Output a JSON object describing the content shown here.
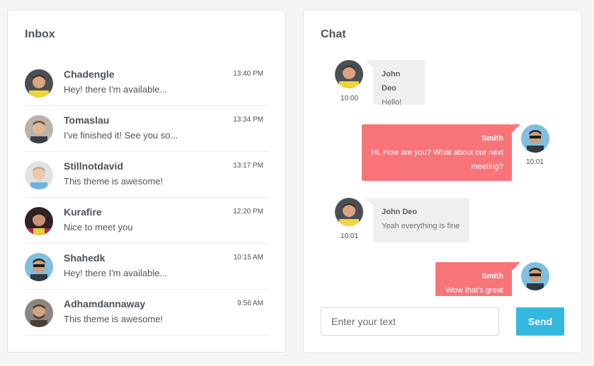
{
  "colors": {
    "page_bg": "#f5f5f5",
    "accent": "#35b8e0",
    "outgoing_bubble": "#f87479",
    "incoming_bubble": "#eeeff0"
  },
  "inbox": {
    "title": "Inbox",
    "items": [
      {
        "name": "Chadengle",
        "message": "Hey! there I'm available...",
        "time": "13:40 PM",
        "avatar": "avatar-icon"
      },
      {
        "name": "Tomaslau",
        "message": "I've finished it! See you so...",
        "time": "13:34 PM",
        "avatar": "avatar-icon"
      },
      {
        "name": "Stillnotdavid",
        "message": "This theme is awesome!",
        "time": "13:17 PM",
        "avatar": "avatar-icon"
      },
      {
        "name": "Kurafire",
        "message": "Nice to meet you",
        "time": "12:20 PM",
        "avatar": "avatar-icon"
      },
      {
        "name": "Shahedk",
        "message": "Hey! there I'm available...",
        "time": "10:15 AM",
        "avatar": "avatar-icon"
      },
      {
        "name": "Adhamdannaway",
        "message": "This theme is awesome!",
        "time": "9:56 AM",
        "avatar": "avatar-icon"
      }
    ]
  },
  "chat": {
    "title": "Chat",
    "messages": [
      {
        "sender": "John Deo",
        "text": "Hello!",
        "time": "10:00",
        "direction": "incoming"
      },
      {
        "sender": "Smith",
        "text_line1": "Hi, How are you? What about our next",
        "text_line2": "meeting?",
        "time": "10:01",
        "direction": "outgoing"
      },
      {
        "sender": "John Deo",
        "text": "Yeah everything is fine",
        "time": "10:01",
        "direction": "incoming"
      },
      {
        "sender": "Smith",
        "text": "Wow that's great",
        "direction": "outgoing"
      }
    ],
    "input_placeholder": "Enter your text",
    "send_label": "Send"
  }
}
